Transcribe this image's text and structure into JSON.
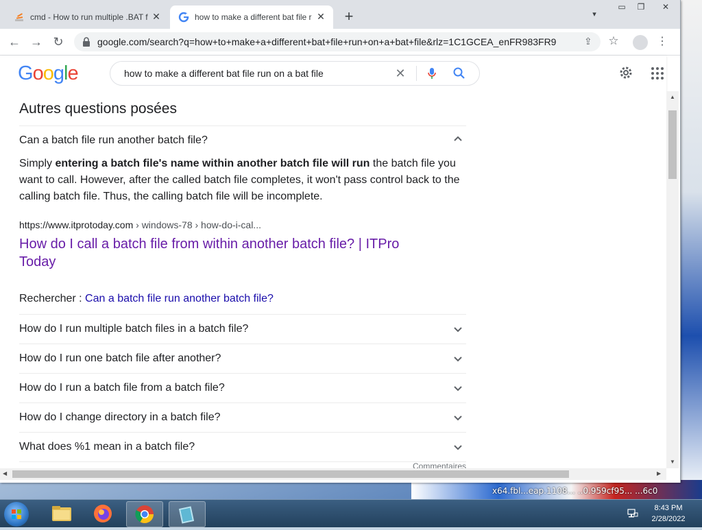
{
  "desktop": {
    "background_text": "x64.fbl...eap.1108... ..0.959cf95... ...6c0"
  },
  "browser": {
    "tabs": [
      {
        "title": "cmd - How to run multiple .BAT f",
        "active": false
      },
      {
        "title": "how to make a different bat file r",
        "active": true
      }
    ],
    "url": "google.com/search?q=how+to+make+a+different+bat+file+run+on+a+bat+file&rlz=1C1GCEA_enFR983FR983..."
  },
  "google": {
    "logo_letters": [
      "G",
      "o",
      "o",
      "g",
      "l",
      "e"
    ],
    "logo_colors": [
      "#4285f4",
      "#ea4335",
      "#fbbc05",
      "#4285f4",
      "#34a853",
      "#ea4335"
    ],
    "query": "how to make a different bat file run on a bat file"
  },
  "paa": {
    "heading": "Autres questions posées",
    "open_question": "Can a batch file run another batch file?",
    "answer_pre": "Simply ",
    "answer_bold": "entering a batch file's name within another batch file will run",
    "answer_post": " the batch file you want to call. However, after the called batch file completes, it won't pass control back to the calling batch file. Thus, the calling batch file will be incomplete.",
    "cite_host": "https://www.itprotoday.com",
    "cite_path": " › windows-78 › how-do-i-cal...",
    "result_title": "How do I call a batch file from within another batch file? | ITPro Today",
    "search_label": "Rechercher : ",
    "search_link": "Can a batch file run another batch file?",
    "questions": [
      "How do I run multiple batch files in a batch file?",
      "How do I run one batch file after another?",
      "How do I run a batch file from a batch file?",
      "How do I change directory in a batch file?",
      "What does %1 mean in a batch file?"
    ],
    "feedback": "Commentaires"
  },
  "taskbar": {
    "time": "8:43 PM",
    "date": "2/28/2022"
  },
  "colors": {
    "link_visited": "#681da8",
    "link": "#1a0dab",
    "text": "#202124",
    "taskbar": "#2a4a6a"
  }
}
